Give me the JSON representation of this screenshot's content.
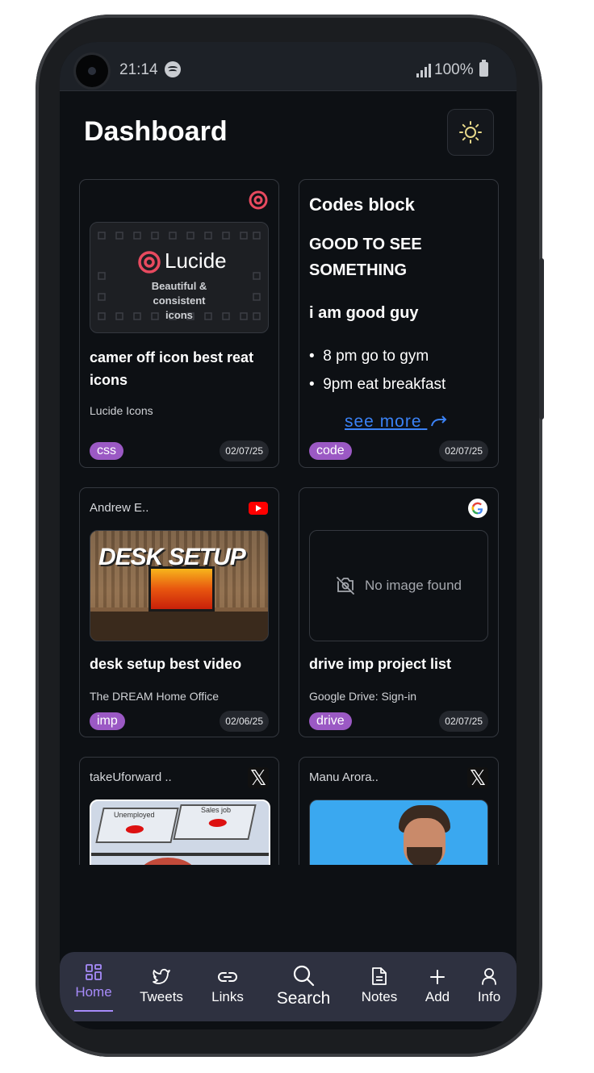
{
  "status_bar": {
    "time": "21:14",
    "battery": "100%"
  },
  "page_title": "Dashboard",
  "cards": [
    {
      "author": "",
      "source_icon": "lucide-icon",
      "thumb_text_main": "Lucide",
      "thumb_text_sub": "Beautiful & consistent icons",
      "title": "camer off icon best reat icons",
      "subtitle": "Lucide Icons",
      "tag": "css",
      "date": "02/07/25"
    },
    {
      "heading": "Codes block",
      "heading2": "GOOD TO SEE SOMETHING",
      "heading3": "i am good guy",
      "list": [
        "8 pm go to gym",
        "9pm eat breakfast"
      ],
      "see_more": "see more",
      "tag": "code",
      "date": "02/07/25"
    },
    {
      "author": "Andrew E..",
      "source_icon": "youtube-icon",
      "thumb_text_main": "DESK SETUP",
      "title": "desk setup best video",
      "subtitle": "The DREAM Home Office",
      "tag": "imp",
      "date": "02/06/25"
    },
    {
      "author": "",
      "source_icon": "google-icon",
      "thumb_text_main": "No image found",
      "title": "drive imp project list",
      "subtitle": "Google Drive: Sign-in",
      "tag": "drive",
      "date": "02/07/25"
    },
    {
      "author": "takeUforward ..",
      "source_icon": "x-icon",
      "thumb_text_main": "Unemployed",
      "thumb_text_sub": "Sales job"
    },
    {
      "author": "Manu Arora..",
      "source_icon": "x-icon"
    }
  ],
  "nav": [
    {
      "label": "Home",
      "icon": "grid-icon"
    },
    {
      "label": "Tweets",
      "icon": "twitter-icon"
    },
    {
      "label": "Links",
      "icon": "link-icon"
    },
    {
      "label": "Search",
      "icon": "search-icon"
    },
    {
      "label": "Notes",
      "icon": "note-icon"
    },
    {
      "label": "Add",
      "icon": "plus-icon"
    },
    {
      "label": "Info",
      "icon": "user-icon"
    }
  ],
  "colors": {
    "background": "#0d1014",
    "tag": "#9b59c4",
    "accent": "#a78bfa",
    "link": "#3b82f6",
    "navbar": "#2e3140"
  }
}
